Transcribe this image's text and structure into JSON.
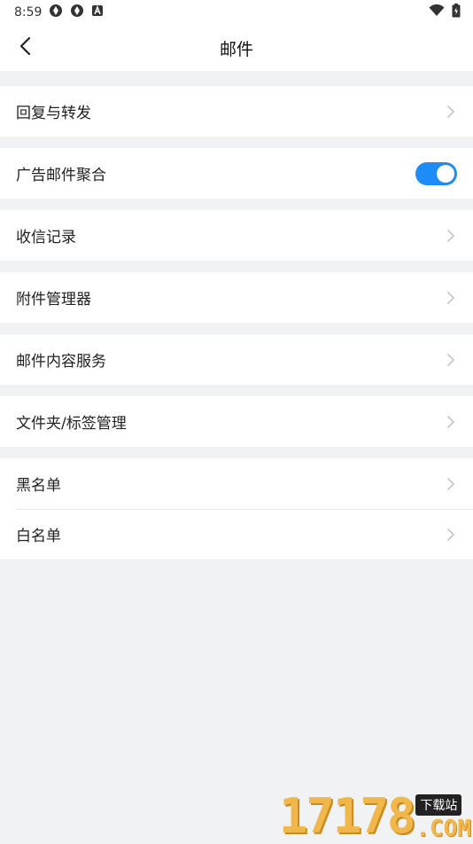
{
  "status_bar": {
    "time": "8:59",
    "icons": [
      "app-notification-icon",
      "app-notification-icon",
      "a-letter-icon",
      "wifi-icon",
      "battery-icon"
    ]
  },
  "header": {
    "title": "邮件",
    "back_icon": "chevron-left-icon"
  },
  "settings": {
    "reply_forward": "回复与转发",
    "ad_aggregation": "广告邮件聚合",
    "ad_aggregation_enabled": true,
    "receipt_records": "收信记录",
    "attachment_manager": "附件管理器",
    "content_service": "邮件内容服务",
    "folder_tag_manage": "文件夹/标签管理",
    "blacklist": "黑名单",
    "whitelist": "白名单"
  },
  "watermark": {
    "digits": "17178",
    "badge": "下载站",
    "domain": ".COM"
  },
  "colors": {
    "accent": "#1d8cf8",
    "background": "#f1f2f4",
    "surface": "#ffffff",
    "chevron": "#c4c4c8"
  }
}
